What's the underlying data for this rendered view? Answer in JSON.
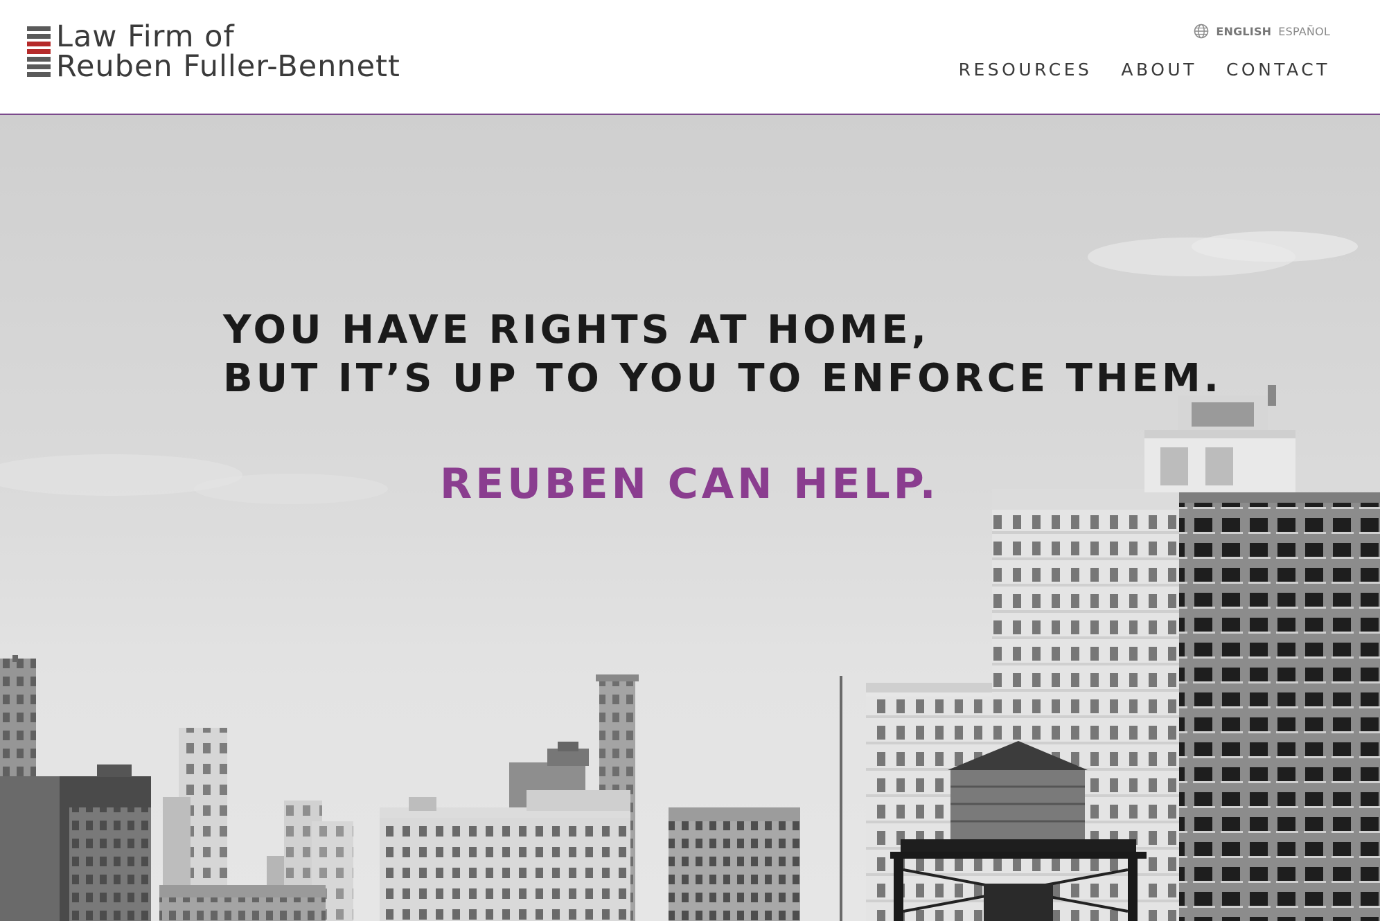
{
  "header": {
    "logo": {
      "line1": "Law Firm of",
      "line2": "Reuben Fuller-Bennett"
    },
    "language": {
      "icon": "globe-icon",
      "active": "ENGLISH",
      "other": "ESPAÑOL"
    },
    "nav": [
      {
        "label": "RESOURCES"
      },
      {
        "label": "ABOUT"
      },
      {
        "label": "CONTACT"
      }
    ]
  },
  "hero": {
    "headline_line1": "YOU HAVE RIGHTS AT HOME,",
    "headline_line2": "BUT IT’S UP TO YOU TO ENFORCE THEM.",
    "tagline": "REUBEN CAN HELP."
  },
  "colors": {
    "accent_purple": "#8a3d8f",
    "header_rule": "#7b4a8c",
    "logo_red": "#b52a2a",
    "text_dark": "#3a3a3a"
  }
}
